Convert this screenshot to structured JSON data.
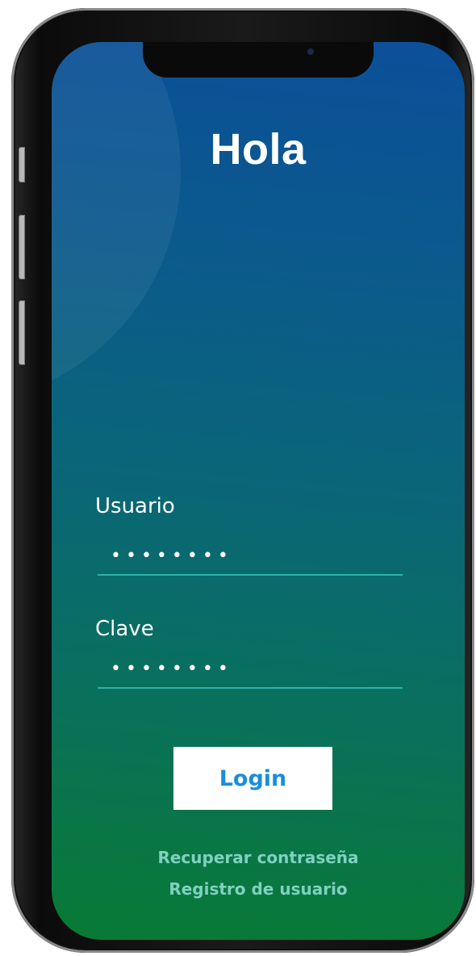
{
  "screen": {
    "title": "Hola"
  },
  "form": {
    "username_label": "Usuario",
    "username_value": "••••••••",
    "password_label": "Clave",
    "password_value": "••••••••"
  },
  "actions": {
    "login_label": "Login",
    "recover_link": "Recuperar contraseña",
    "register_link": "Registro de usuario"
  },
  "colors": {
    "gradient_top": "#0b4f99",
    "gradient_bottom": "#097a34",
    "field_underline": "#2bb3a8",
    "login_text": "#1a8ddd",
    "link_text": "#7fd1c0"
  }
}
